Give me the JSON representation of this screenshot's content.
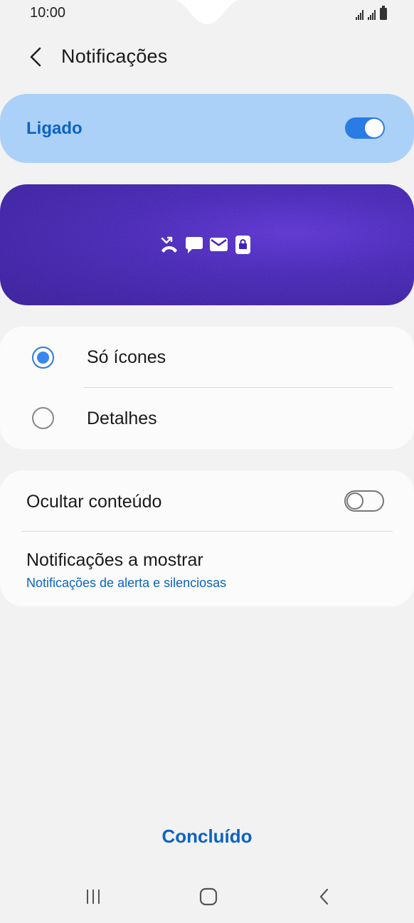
{
  "status_bar": {
    "time": "10:00"
  },
  "header": {
    "title": "Notificações",
    "back_icon": "chevron-left-icon"
  },
  "master_switch": {
    "label": "Ligado",
    "state": "on",
    "accent": "#2a7be4",
    "background": "#acd1f8"
  },
  "preview": {
    "icons": [
      "missed-call-icon",
      "message-icon",
      "email-icon",
      "lock-icon"
    ],
    "background": "#4421b8"
  },
  "style_options": {
    "items": [
      {
        "label": "Só ícones",
        "selected": true
      },
      {
        "label": "Detalhes",
        "selected": false
      }
    ]
  },
  "settings": {
    "hide_content": {
      "label": "Ocultar conteúdo",
      "state": "off"
    },
    "notifications_to_show": {
      "label": "Notificações a mostrar",
      "value": "Notificações de alerta e silenciosas"
    }
  },
  "footer": {
    "done_label": "Concluído"
  },
  "nav_bar": {
    "icons": [
      "recents-icon",
      "home-icon",
      "back-icon"
    ]
  },
  "colors": {
    "link_blue": "#0b63c4",
    "page_bg": "#f2f2f2",
    "card_bg": "#fbfbfb"
  }
}
